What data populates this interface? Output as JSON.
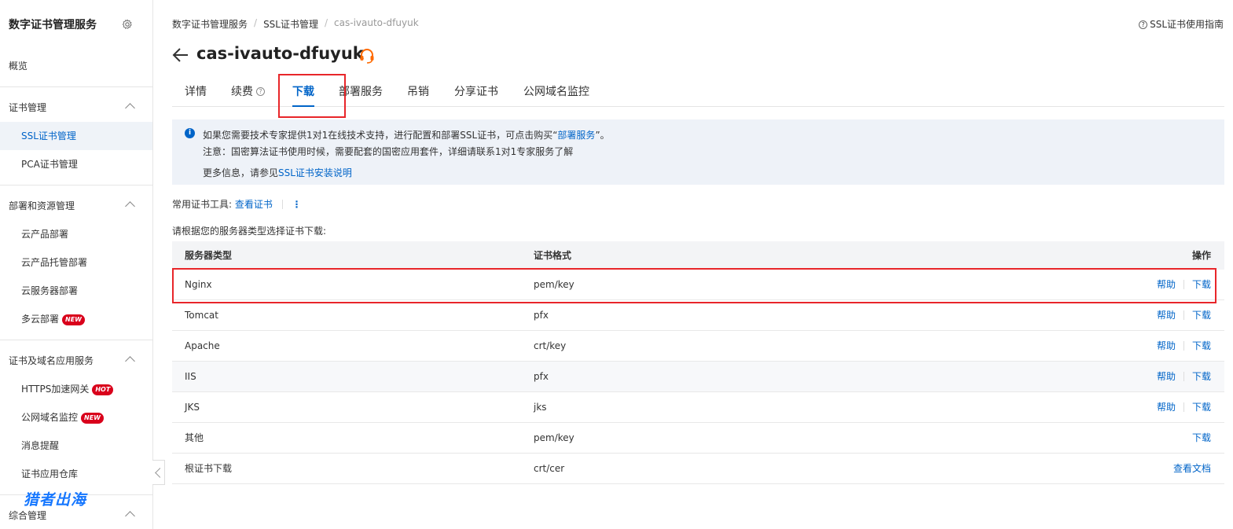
{
  "sidebar": {
    "title": "数字证书管理服务",
    "overview": "概览",
    "groups": [
      {
        "label": "证书管理",
        "items": [
          "SSL证书管理",
          "PCA证书管理"
        ]
      },
      {
        "label": "部署和资源管理",
        "items": [
          "云产品部署",
          "云产品托管部署",
          "云服务器部署",
          "多云部署"
        ]
      },
      {
        "label": "证书及域名应用服务",
        "items": [
          "HTTPS加速网关",
          "公网域名监控",
          "消息提醒",
          "证书应用仓库"
        ]
      },
      {
        "label": "综合管理",
        "items": []
      }
    ],
    "badges": {
      "new": "NEW",
      "hot": "HOT"
    },
    "watermark": "猎者出海"
  },
  "breadcrumb": [
    "数字证书管理服务",
    "SSL证书管理",
    "cas-ivauto-dfuyuk"
  ],
  "guide_link": "SSL证书使用指南",
  "page_title": "cas-ivauto-dfuyuk",
  "tabs": [
    "详情",
    "续费",
    "下载",
    "部署服务",
    "吊销",
    "分享证书",
    "公网域名监控"
  ],
  "active_tab": "下载",
  "info": {
    "line1_prefix": "如果您需要技术专家提供1对1在线技术支持，进行配置和部署SSL证书，可点击购买“",
    "line1_link": "部署服务",
    "line1_suffix": "”。",
    "line2": "注意：国密算法证书使用时候，需要配套的国密应用套件，详细请联系1对1专家服务了解",
    "line3_prefix": "更多信息，请参见",
    "line3_link": "SSL证书安装说明"
  },
  "tools": {
    "label": "常用证书工具:",
    "link": "查看证书",
    "more": "⋮"
  },
  "select_hint": "请根据您的服务器类型选择证书下载:",
  "table": {
    "headers": [
      "服务器类型",
      "证书格式",
      "操作"
    ],
    "rows": [
      {
        "server": "Nginx",
        "format": "pem/key",
        "help": "帮助",
        "action": "下载"
      },
      {
        "server": "Tomcat",
        "format": "pfx",
        "help": "帮助",
        "action": "下载"
      },
      {
        "server": "Apache",
        "format": "crt/key",
        "help": "帮助",
        "action": "下载"
      },
      {
        "server": "IIS",
        "format": "pfx",
        "help": "帮助",
        "action": "下载"
      },
      {
        "server": "JKS",
        "format": "jks",
        "help": "帮助",
        "action": "下载"
      },
      {
        "server": "其他",
        "format": "pem/key",
        "help": "",
        "action": "下载"
      },
      {
        "server": "根证书下载",
        "format": "crt/cer",
        "help": "",
        "action": "查看文档"
      }
    ]
  },
  "colors": {
    "accent": "#0064c8",
    "highlight": "#e8262a",
    "badge": "#d9001b",
    "support_icon": "#ff6a00"
  }
}
